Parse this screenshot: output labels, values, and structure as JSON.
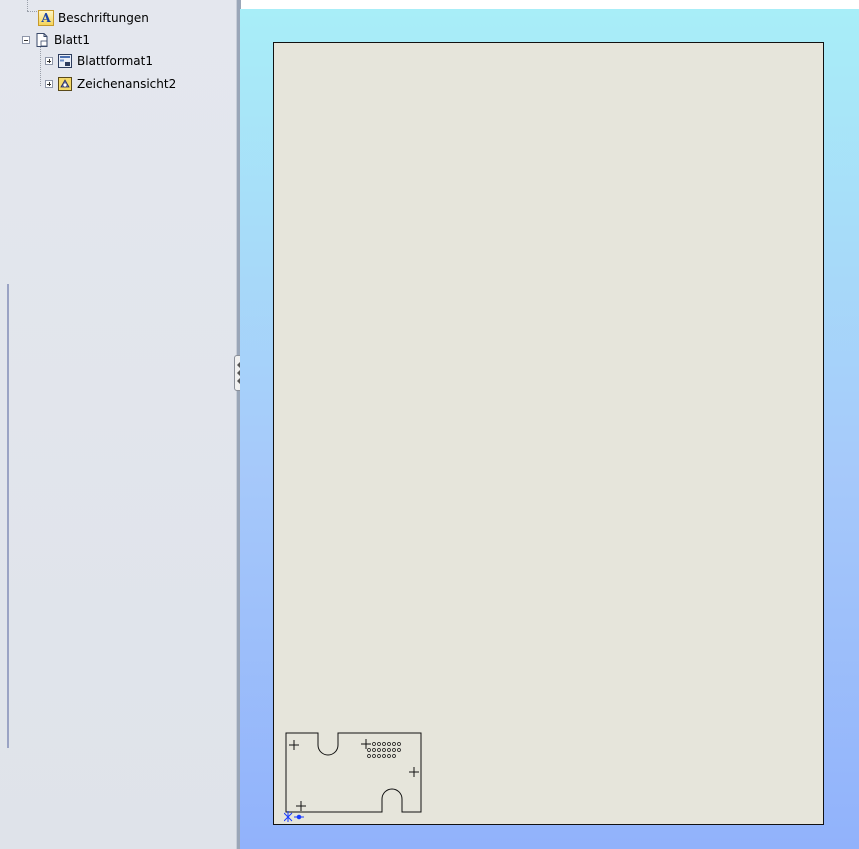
{
  "tree": {
    "items": [
      {
        "label": "Beschriftungen",
        "icon": "annotations-icon"
      },
      {
        "label": "Blatt1",
        "icon": "sheet-icon",
        "expander": "collapse"
      },
      {
        "label": "Blattformat1",
        "icon": "sheet-format-icon",
        "expander": "expand"
      },
      {
        "label": "Zeichenansicht2",
        "icon": "drawing-view-icon",
        "expander": "expand"
      }
    ],
    "annotation_letter": "A"
  },
  "colors": {
    "tree_bg": "#e4e7ee",
    "sheet_bg": "#e6e5db",
    "viewport_top": "#a8eef8",
    "viewport_bottom": "#91b2fb",
    "origin_marker": "#1a3cff"
  }
}
